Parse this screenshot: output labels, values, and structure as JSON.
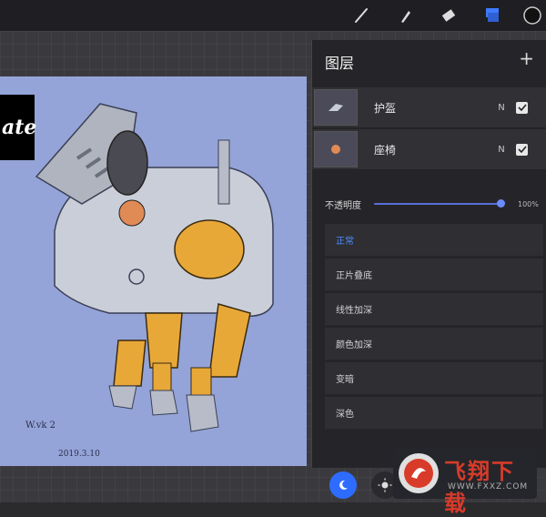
{
  "layers_panel": {
    "title": "图层",
    "add_icon": "plus-icon",
    "layers": [
      {
        "name": "护盔",
        "mode": "N",
        "visible": true
      },
      {
        "name": "座椅",
        "mode": "N",
        "visible": true
      }
    ],
    "opacity": {
      "label": "不透明度",
      "value": "100%",
      "level": 1.0
    },
    "blend_modes": [
      {
        "label": "正常",
        "selected": true
      },
      {
        "label": "正片叠底",
        "selected": false
      },
      {
        "label": "线性加深",
        "selected": false
      },
      {
        "label": "颜色加深",
        "selected": false
      },
      {
        "label": "变暗",
        "selected": false
      },
      {
        "label": "深色",
        "selected": false
      }
    ]
  },
  "toolbar": {
    "tools": [
      "brush-icon",
      "smudge-icon",
      "eraser-icon",
      "layers-icon",
      "color-icon"
    ]
  },
  "canvas": {
    "badge_text": "ate",
    "signature": "W.vk 2",
    "signature_date": "2019.3.10"
  },
  "watermark": {
    "brand": "飞翔下载",
    "url": "WWW.FXXZ.COM"
  },
  "colors": {
    "accent": "#4d8dff",
    "canvas_bg": "#94a4d8",
    "panel_bg": "#242428",
    "robot_orange": "#e8a838"
  }
}
